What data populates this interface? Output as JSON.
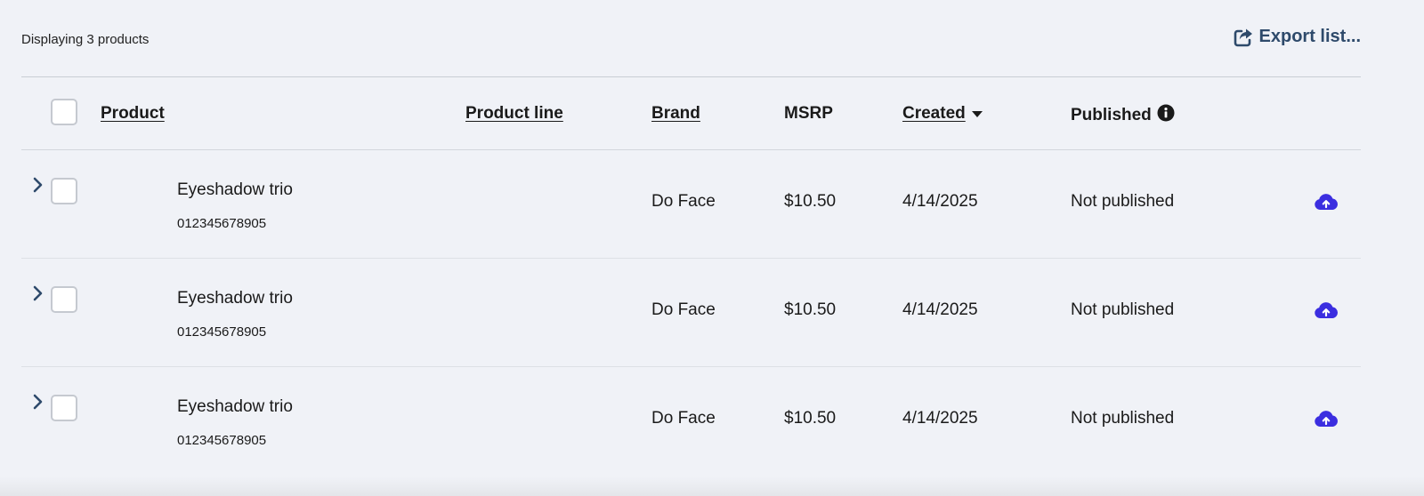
{
  "toolbar": {
    "count_text": "Displaying 3 products",
    "export_label": "Export list..."
  },
  "table": {
    "columns": [
      {
        "label": "Product",
        "sortable": true
      },
      {
        "label": "Product line",
        "sortable": true
      },
      {
        "label": "Brand",
        "sortable": true
      },
      {
        "label": "MSRP",
        "sortable": false
      },
      {
        "label": "Created",
        "sortable": true,
        "sort": "descending"
      },
      {
        "label": "Published",
        "sortable": false,
        "info_icon": true
      }
    ],
    "rows": [
      {
        "product": "Eyeshadow trio",
        "sku": "012345678905",
        "product_line": "",
        "brand": "Do Face",
        "msrp": "$10.50",
        "created": "4/14/2025",
        "published": "Not published"
      },
      {
        "product": "Eyeshadow trio",
        "sku": "012345678905",
        "product_line": "",
        "brand": "Do Face",
        "msrp": "$10.50",
        "created": "4/14/2025",
        "published": "Not published"
      },
      {
        "product": "Eyeshadow trio",
        "sku": "012345678905",
        "product_line": "",
        "brand": "Do Face",
        "msrp": "$10.50",
        "created": "4/14/2025",
        "published": "Not published"
      }
    ]
  },
  "colors": {
    "background": "#f0f2f7",
    "export_text": "#2e4a6b",
    "upload_icon": "#3b2ee0"
  },
  "icons": {
    "export": "export-icon",
    "sort": "caret-down-icon",
    "info": "info-icon",
    "expand": "chevron-right-icon",
    "publish": "cloud-upload-icon"
  }
}
